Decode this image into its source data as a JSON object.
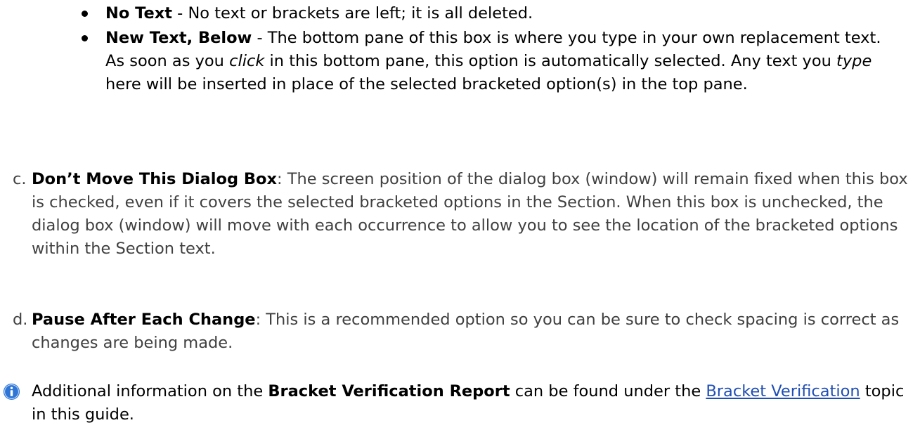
{
  "bullets": [
    {
      "term": "No Text",
      "text": " - No text or brackets are left; it is all deleted."
    },
    {
      "term": "New Text, Below",
      "text_1": " - The bottom pane of this box is where you type in your own replacement text. As soon as you ",
      "em_1": "click",
      "text_2": " in this bottom pane, this option is automatically selected. Any text you ",
      "em_2": "type",
      "text_3": " here will be inserted in place of the selected bracketed option(s) in the top pane."
    }
  ],
  "items": {
    "c": {
      "letter": "c.",
      "term": "Don’t Move This Dialog Box",
      "text": ": The screen position of the dialog box (window) will remain fixed when this box is checked, even if it covers the selected bracketed options in the Section. When this box is unchecked, the dialog box (window) will move with each occurrence to allow you to see the location of the bracketed options within the Section text."
    },
    "d": {
      "letter": "d.",
      "term": "Pause After Each Change",
      "text": ": This is a recommended option so you can be sure to check spacing is correct as changes are being made."
    }
  },
  "note": {
    "icon": "info-icon",
    "text_1": "Additional information on the ",
    "term": "Bracket Verification Report",
    "text_2": " can be found under the ",
    "link": "Bracket Verification",
    "text_3": " topic in this guide."
  },
  "colors": {
    "body_text": "#404040",
    "link": "#1f4eb4",
    "icon_blue": "#2e75d6"
  }
}
